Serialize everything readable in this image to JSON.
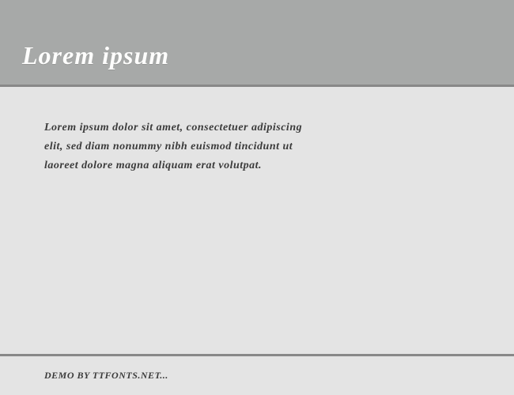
{
  "header": {
    "title": "Lorem ipsum"
  },
  "content": {
    "body_text": "Lorem ipsum dolor sit amet, consectetuer adipiscing elit, sed diam nonummy nibh euismod tincidunt ut laoreet dolore magna aliquam erat volutpat."
  },
  "footer": {
    "text": "DEMO BY TTFONTS.NET..."
  }
}
